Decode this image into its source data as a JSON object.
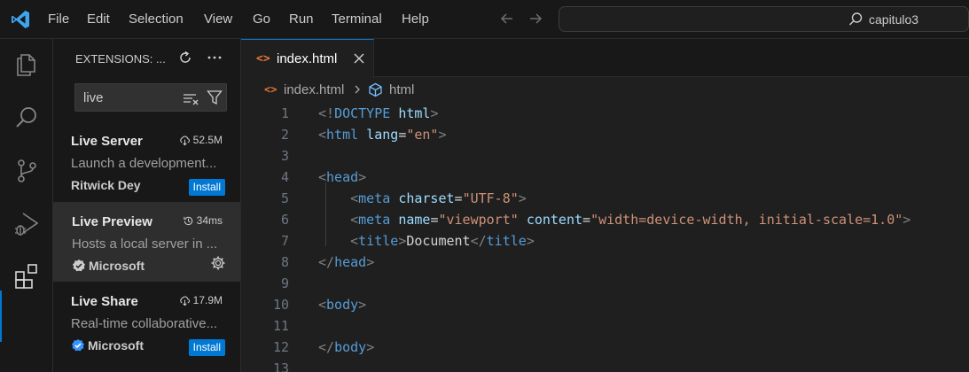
{
  "menu": [
    "File",
    "Edit",
    "Selection",
    "View",
    "Go",
    "Run",
    "Terminal",
    "Help"
  ],
  "command_center": {
    "label": "capitulo3"
  },
  "sidebar": {
    "title": "EXTENSIONS: ...",
    "search_value": "live",
    "extensions": [
      {
        "name": "Live Server",
        "stat": "52.5M",
        "stat_icon": "cloud-download-icon",
        "description": "Launch a development...",
        "publisher": "Ritwick Dey",
        "verified": false,
        "action": "Install"
      },
      {
        "name": "Live Preview",
        "stat": "34ms",
        "stat_icon": "history-icon",
        "description": "Hosts a local server in ...",
        "publisher": "Microsoft",
        "verified": true,
        "action": "gear"
      },
      {
        "name": "Live Share",
        "stat": "17.9M",
        "stat_icon": "cloud-download-icon",
        "description": "Real-time collaborative...",
        "publisher": "Microsoft",
        "verified": true,
        "action": "Install"
      }
    ]
  },
  "editor": {
    "tab": {
      "icon": "<>",
      "label": "index.html"
    },
    "breadcrumb": {
      "file": "index.html",
      "element": "html"
    },
    "line_numbers": [
      "1",
      "2",
      "3",
      "4",
      "5",
      "6",
      "7",
      "8",
      "9",
      "10",
      "11",
      "12",
      "13"
    ],
    "lines": [
      [
        [
          "p",
          "<!"
        ],
        [
          "t",
          "DOCTYPE"
        ],
        [
          "x",
          " "
        ],
        [
          "a",
          "html"
        ],
        [
          "p",
          ">"
        ]
      ],
      [
        [
          "p",
          "<"
        ],
        [
          "t",
          "html"
        ],
        [
          "x",
          " "
        ],
        [
          "a",
          "lang"
        ],
        [
          "x",
          "="
        ],
        [
          "s",
          "\"en\""
        ],
        [
          "p",
          ">"
        ]
      ],
      [],
      [
        [
          "p",
          "<"
        ],
        [
          "t",
          "head"
        ],
        [
          "p",
          ">"
        ]
      ],
      [
        [
          "x",
          "    "
        ],
        [
          "p",
          "<"
        ],
        [
          "t",
          "meta"
        ],
        [
          "x",
          " "
        ],
        [
          "a",
          "charset"
        ],
        [
          "x",
          "="
        ],
        [
          "s",
          "\"UTF-8\""
        ],
        [
          "p",
          ">"
        ]
      ],
      [
        [
          "x",
          "    "
        ],
        [
          "p",
          "<"
        ],
        [
          "t",
          "meta"
        ],
        [
          "x",
          " "
        ],
        [
          "a",
          "name"
        ],
        [
          "x",
          "="
        ],
        [
          "s",
          "\"viewport\""
        ],
        [
          "x",
          " "
        ],
        [
          "a",
          "content"
        ],
        [
          "x",
          "="
        ],
        [
          "s",
          "\"width=device-width, initial-scale=1.0\""
        ],
        [
          "p",
          ">"
        ]
      ],
      [
        [
          "x",
          "    "
        ],
        [
          "p",
          "<"
        ],
        [
          "t",
          "title"
        ],
        [
          "p",
          ">"
        ],
        [
          "x",
          "Document"
        ],
        [
          "p",
          "</"
        ],
        [
          "t",
          "title"
        ],
        [
          "p",
          ">"
        ]
      ],
      [
        [
          "p",
          "</"
        ],
        [
          "t",
          "head"
        ],
        [
          "p",
          ">"
        ]
      ],
      [],
      [
        [
          "p",
          "<"
        ],
        [
          "t",
          "body"
        ],
        [
          "p",
          ">"
        ]
      ],
      [],
      [
        [
          "p",
          "</"
        ],
        [
          "t",
          "body"
        ],
        [
          "p",
          ">"
        ]
      ],
      []
    ]
  },
  "colors": {
    "accent": "#0078d4",
    "tag": "#569cd6",
    "attr": "#9cdcfe",
    "string": "#ce9178",
    "punct": "#808080",
    "html_icon": "#e37933"
  }
}
